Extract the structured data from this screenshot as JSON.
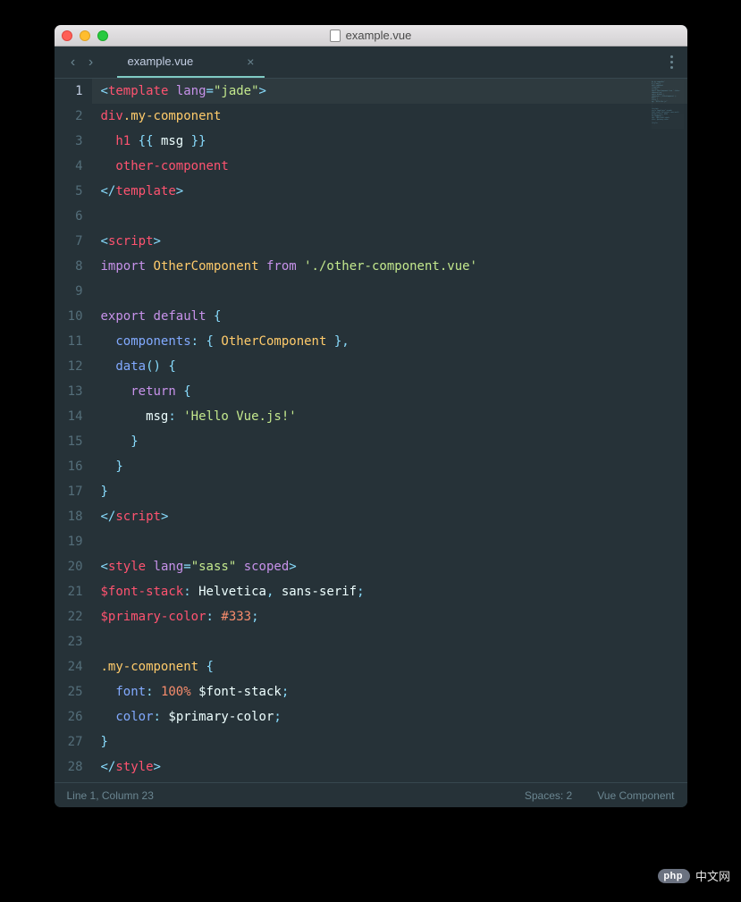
{
  "window": {
    "title": "example.vue"
  },
  "tabs": {
    "active": {
      "label": "example.vue"
    }
  },
  "status": {
    "cursor": "Line 1, Column 23",
    "indent": "Spaces: 2",
    "language": "Vue Component"
  },
  "watermark": {
    "badge": "php",
    "text": "中文网"
  },
  "code_lines": [
    [
      {
        "t": "<",
        "c": "p"
      },
      {
        "t": "template",
        "c": "t"
      },
      {
        "t": " ",
        "c": "v"
      },
      {
        "t": "lang",
        "c": "a"
      },
      {
        "t": "=",
        "c": "p"
      },
      {
        "t": "\"jade\"",
        "c": "s"
      },
      {
        "t": ">",
        "c": "p"
      }
    ],
    [
      {
        "t": "div",
        "c": "t"
      },
      {
        "t": ".my-component",
        "c": "sel"
      }
    ],
    [
      {
        "t": "  ",
        "c": "v"
      },
      {
        "t": "h1",
        "c": "t"
      },
      {
        "t": " ",
        "c": "v"
      },
      {
        "t": "{{ ",
        "c": "p"
      },
      {
        "t": "msg",
        "c": "v"
      },
      {
        "t": " }}",
        "c": "p"
      }
    ],
    [
      {
        "t": "  ",
        "c": "v"
      },
      {
        "t": "other-component",
        "c": "t"
      }
    ],
    [
      {
        "t": "</",
        "c": "p"
      },
      {
        "t": "template",
        "c": "t"
      },
      {
        "t": ">",
        "c": "p"
      }
    ],
    [],
    [
      {
        "t": "<",
        "c": "p"
      },
      {
        "t": "script",
        "c": "t"
      },
      {
        "t": ">",
        "c": "p"
      }
    ],
    [
      {
        "t": "import",
        "c": "a"
      },
      {
        "t": " ",
        "c": "v"
      },
      {
        "t": "OtherComponent",
        "c": "y"
      },
      {
        "t": " ",
        "c": "v"
      },
      {
        "t": "from",
        "c": "a"
      },
      {
        "t": " ",
        "c": "v"
      },
      {
        "t": "'./other-component.vue'",
        "c": "s"
      }
    ],
    [],
    [
      {
        "t": "export",
        "c": "a"
      },
      {
        "t": " ",
        "c": "v"
      },
      {
        "t": "default",
        "c": "a"
      },
      {
        "t": " ",
        "c": "v"
      },
      {
        "t": "{",
        "c": "p"
      }
    ],
    [
      {
        "t": "  ",
        "c": "v"
      },
      {
        "t": "components",
        "c": "c"
      },
      {
        "t": ":",
        "c": "p"
      },
      {
        "t": " ",
        "c": "v"
      },
      {
        "t": "{",
        "c": "p"
      },
      {
        "t": " ",
        "c": "v"
      },
      {
        "t": "OtherComponent",
        "c": "y"
      },
      {
        "t": " ",
        "c": "v"
      },
      {
        "t": "}",
        "c": "p"
      },
      {
        "t": ",",
        "c": "p"
      }
    ],
    [
      {
        "t": "  ",
        "c": "v"
      },
      {
        "t": "data",
        "c": "c"
      },
      {
        "t": "()",
        "c": "p"
      },
      {
        "t": " ",
        "c": "v"
      },
      {
        "t": "{",
        "c": "p"
      }
    ],
    [
      {
        "t": "    ",
        "c": "v"
      },
      {
        "t": "return",
        "c": "a"
      },
      {
        "t": " ",
        "c": "v"
      },
      {
        "t": "{",
        "c": "p"
      }
    ],
    [
      {
        "t": "      ",
        "c": "v"
      },
      {
        "t": "msg",
        "c": "v"
      },
      {
        "t": ":",
        "c": "p"
      },
      {
        "t": " ",
        "c": "v"
      },
      {
        "t": "'Hello Vue.js!'",
        "c": "s"
      }
    ],
    [
      {
        "t": "    ",
        "c": "v"
      },
      {
        "t": "}",
        "c": "p"
      }
    ],
    [
      {
        "t": "  ",
        "c": "v"
      },
      {
        "t": "}",
        "c": "p"
      }
    ],
    [
      {
        "t": "}",
        "c": "p"
      }
    ],
    [
      {
        "t": "</",
        "c": "p"
      },
      {
        "t": "script",
        "c": "t"
      },
      {
        "t": ">",
        "c": "p"
      }
    ],
    [],
    [
      {
        "t": "<",
        "c": "p"
      },
      {
        "t": "style",
        "c": "t"
      },
      {
        "t": " ",
        "c": "v"
      },
      {
        "t": "lang",
        "c": "a"
      },
      {
        "t": "=",
        "c": "p"
      },
      {
        "t": "\"sass\"",
        "c": "s"
      },
      {
        "t": " ",
        "c": "v"
      },
      {
        "t": "scoped",
        "c": "a"
      },
      {
        "t": ">",
        "c": "p"
      }
    ],
    [
      {
        "t": "$font-stack",
        "c": "t"
      },
      {
        "t": ":",
        "c": "p"
      },
      {
        "t": " ",
        "c": "v"
      },
      {
        "t": "Helvetica",
        "c": "v"
      },
      {
        "t": ",",
        "c": "p"
      },
      {
        "t": " ",
        "c": "v"
      },
      {
        "t": "sans-serif",
        "c": "v"
      },
      {
        "t": ";",
        "c": "p"
      }
    ],
    [
      {
        "t": "$primary-color",
        "c": "t"
      },
      {
        "t": ":",
        "c": "p"
      },
      {
        "t": " ",
        "c": "v"
      },
      {
        "t": "#333",
        "c": "o"
      },
      {
        "t": ";",
        "c": "p"
      }
    ],
    [],
    [
      {
        "t": ".my-component",
        "c": "sel"
      },
      {
        "t": " ",
        "c": "v"
      },
      {
        "t": "{",
        "c": "p"
      }
    ],
    [
      {
        "t": "  ",
        "c": "v"
      },
      {
        "t": "font",
        "c": "c"
      },
      {
        "t": ":",
        "c": "p"
      },
      {
        "t": " ",
        "c": "v"
      },
      {
        "t": "100%",
        "c": "o"
      },
      {
        "t": " ",
        "c": "v"
      },
      {
        "t": "$font-stack",
        "c": "v"
      },
      {
        "t": ";",
        "c": "p"
      }
    ],
    [
      {
        "t": "  ",
        "c": "v"
      },
      {
        "t": "color",
        "c": "c"
      },
      {
        "t": ":",
        "c": "p"
      },
      {
        "t": " ",
        "c": "v"
      },
      {
        "t": "$primary-color",
        "c": "v"
      },
      {
        "t": ";",
        "c": "p"
      }
    ],
    [
      {
        "t": "}",
        "c": "p"
      }
    ],
    [
      {
        "t": "</",
        "c": "p"
      },
      {
        "t": "style",
        "c": "t"
      },
      {
        "t": ">",
        "c": "p"
      }
    ]
  ]
}
